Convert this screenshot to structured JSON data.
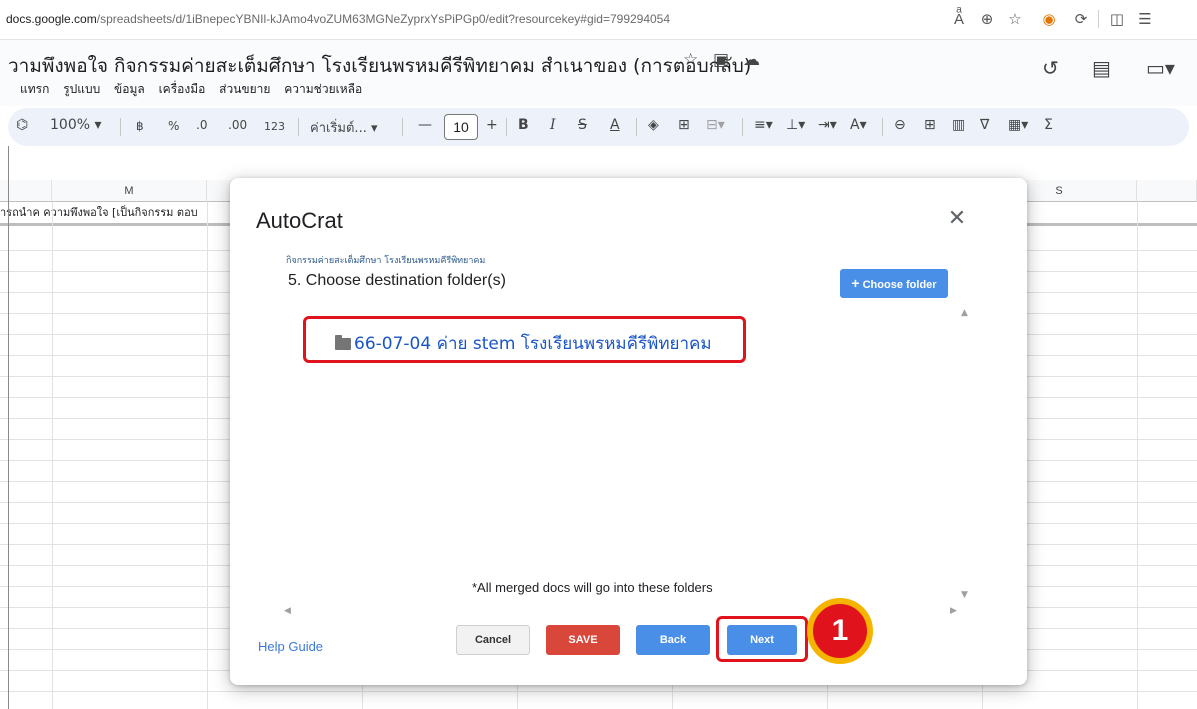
{
  "browser": {
    "url_domain": "docs.google.com",
    "url_rest": "/spreadsheets/d/1iBnepecYBNIl-kJAmo4voZUM63MGNeZyprxYsPiPGp0/edit?resourcekey#gid=799294054"
  },
  "sheet": {
    "title": "วามพึงพอใจ กิจกรรมค่ายสะเต็มศึกษา โรงเรียนพรหมคีรีพิทยาคม สำเนาของ (การตอบกลับ)",
    "menu": [
      "แทรก",
      "รูปแบบ",
      "ข้อมูล",
      "เครื่องมือ",
      "ส่วนขยาย",
      "ความช่วยเหลือ"
    ],
    "toolbar": {
      "zoom": "100%",
      "currency": "฿",
      "percent": "%",
      "dec_decrease": ".0",
      "dec_increase": ".00",
      "number_format": "123",
      "font_name": "ค่าเริ่มต์...",
      "font_size": "10"
    },
    "columns": [
      "M",
      "S"
    ],
    "header_row_text": "ารถนำค ความพึงพอใจ [เป็นกิจกรรม ตอบ"
  },
  "dialog": {
    "title": "AutoCrat",
    "subtitle": "กิจกรรมค่ายสะเต็มศึกษา โรงเรียนพรหมคีรีพิทยาคม",
    "step": "5. Choose destination folder(s)",
    "choose_folder_label": "Choose folder",
    "folder_name": "66-07-04 ค่าย stem โรงเรียนพรหมคีรีพิทยาคม",
    "note": "*All merged docs will go into these folders",
    "help_label": "Help Guide",
    "cancel_label": "Cancel",
    "save_label": "SAVE",
    "back_label": "Back",
    "next_label": "Next",
    "annotation_number": "1"
  },
  "colors": {
    "accent_blue": "#4a8fe7",
    "save_red": "#d9473b",
    "highlight_red": "#e0131c",
    "badge_border": "#f5b400"
  }
}
